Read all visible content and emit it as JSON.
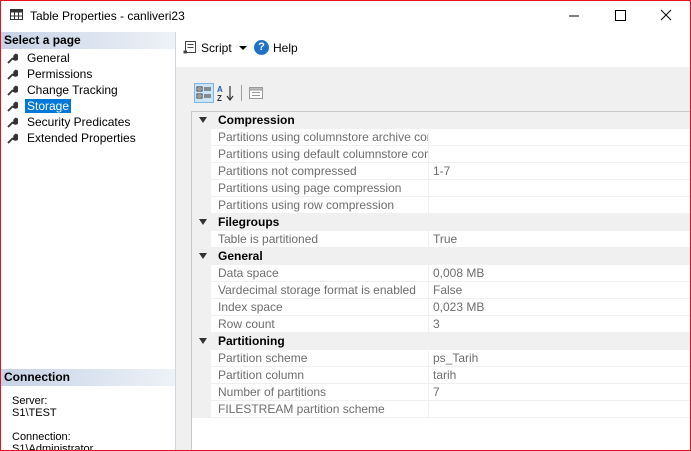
{
  "window": {
    "title": "Table Properties - canliveri23",
    "colors": {
      "border": "#e81123",
      "selection": "#0078d7"
    }
  },
  "left_panel": {
    "select_page_header": "Select a page",
    "pages": [
      {
        "label": "General",
        "icon": "wrench-icon",
        "selected": false
      },
      {
        "label": "Permissions",
        "icon": "wrench-icon",
        "selected": false
      },
      {
        "label": "Change Tracking",
        "icon": "wrench-icon",
        "selected": false
      },
      {
        "label": "Storage",
        "icon": "wrench-icon",
        "selected": true
      },
      {
        "label": "Security Predicates",
        "icon": "wrench-icon",
        "selected": false
      },
      {
        "label": "Extended Properties",
        "icon": "wrench-icon",
        "selected": false
      }
    ],
    "connection_header": "Connection",
    "server_label": "Server:",
    "server_value": "S1\\TEST",
    "connection_label": "Connection:",
    "connection_value": "S1\\Administrator"
  },
  "toolbar": {
    "script_label": "Script",
    "help_label": "Help"
  },
  "property_grid": {
    "categories": [
      {
        "name": "Compression",
        "rows": [
          {
            "name": "Partitions using columnstore archive compres",
            "value": ""
          },
          {
            "name": "Partitions using default columnstore compress",
            "value": ""
          },
          {
            "name": "Partitions not compressed",
            "value": "1-7"
          },
          {
            "name": "Partitions using page compression",
            "value": ""
          },
          {
            "name": "Partitions using row compression",
            "value": ""
          }
        ]
      },
      {
        "name": "Filegroups",
        "rows": [
          {
            "name": "Table is partitioned",
            "value": "True"
          }
        ]
      },
      {
        "name": "General",
        "rows": [
          {
            "name": "Data space",
            "value": "0,008 MB"
          },
          {
            "name": "Vardecimal storage format is enabled",
            "value": "False"
          },
          {
            "name": "Index space",
            "value": "0,023 MB"
          },
          {
            "name": "Row count",
            "value": "3"
          }
        ]
      },
      {
        "name": "Partitioning",
        "rows": [
          {
            "name": "Partition scheme",
            "value": "ps_Tarih"
          },
          {
            "name": "Partition column",
            "value": "tarih"
          },
          {
            "name": "Number of partitions",
            "value": "7"
          },
          {
            "name": "FILESTREAM partition scheme",
            "value": ""
          }
        ]
      }
    ]
  }
}
